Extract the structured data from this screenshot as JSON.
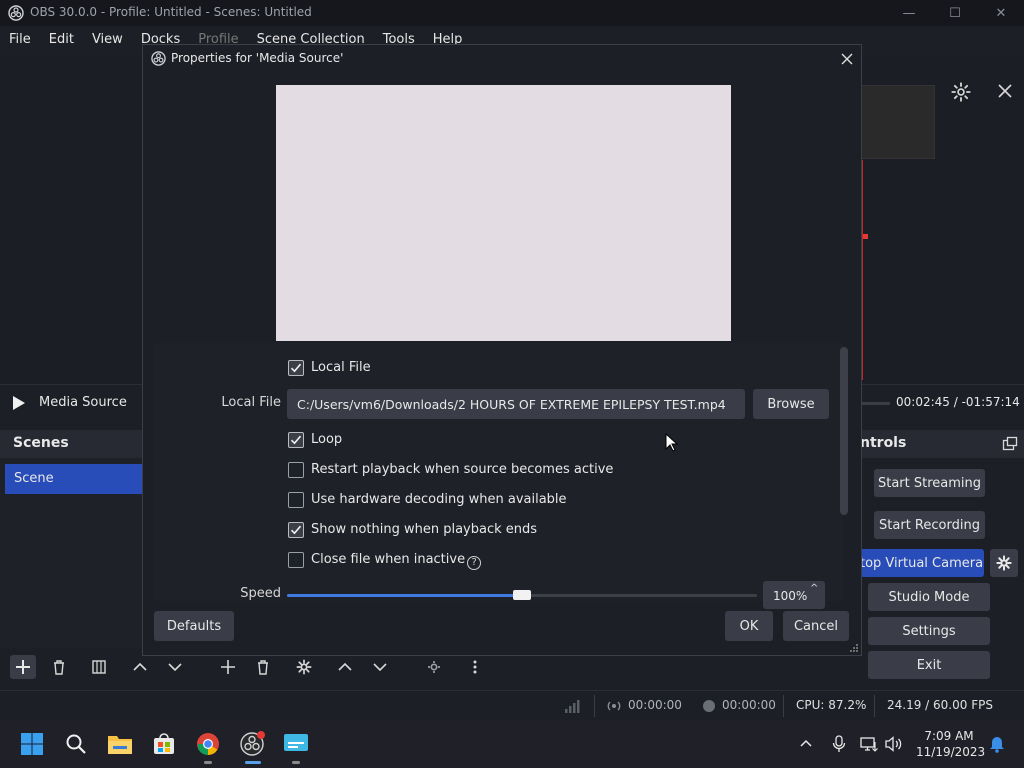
{
  "window": {
    "title": "OBS 30.0.0 - Profile: Untitled - Scenes: Untitled",
    "min_glyph": "—",
    "max_glyph": "☐",
    "close_glyph": "✕"
  },
  "menu": {
    "items": [
      "File",
      "Edit",
      "View",
      "Docks",
      "Profile",
      "Scene Collection",
      "Tools",
      "Help"
    ]
  },
  "media_controls": {
    "source_name": "Media Source",
    "time": "00:02:45  /  -01:57:14"
  },
  "scenes": {
    "header": "Scenes",
    "items": [
      "Scene"
    ]
  },
  "controls": {
    "header": "ntrols",
    "buttons": [
      "Start Streaming",
      "Start Recording",
      "top Virtual Camera",
      "Studio Mode",
      "Settings",
      "Exit"
    ]
  },
  "status": {
    "stream_time": "00:00:00",
    "rec_time": "00:00:00",
    "cpu": "CPU: 87.2%",
    "fps": "24.19 / 60.00 FPS"
  },
  "dialog": {
    "title": "Properties for 'Media Source'",
    "local_file_checkbox": {
      "label": "Local File",
      "checked": true
    },
    "local_file_field": {
      "label": "Local File",
      "value": "C:/Users/vm6/Downloads/2 HOURS OF EXTREME EPILEPSY TEST.mp4",
      "browse_label": "Browse"
    },
    "checkboxes": [
      {
        "label": "Loop",
        "checked": true
      },
      {
        "label": "Restart playback when source becomes active",
        "checked": false
      },
      {
        "label": "Use hardware decoding when available",
        "checked": false
      },
      {
        "label": "Show nothing when playback ends",
        "checked": true
      },
      {
        "label": "Close file when inactive",
        "checked": false
      }
    ],
    "speed": {
      "label": "Speed",
      "value": "100%",
      "fraction": 0.5
    },
    "defaults_label": "Defaults",
    "ok_label": "OK",
    "cancel_label": "Cancel"
  },
  "taskbar": {
    "time": "7:09 AM",
    "date": "11/19/2023"
  }
}
